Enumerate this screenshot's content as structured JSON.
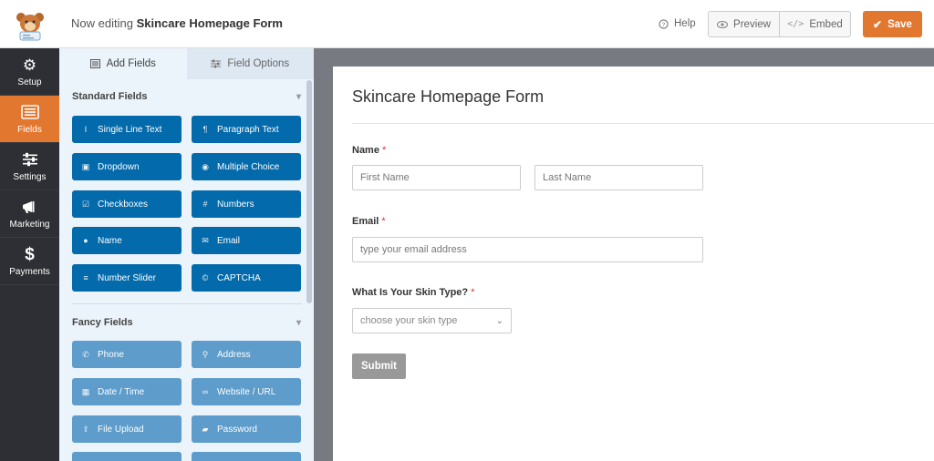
{
  "header": {
    "editing_prefix": "Now editing",
    "form_name": "Skincare Homepage Form",
    "help_label": "Help",
    "preview_label": "Preview",
    "embed_label": "Embed",
    "save_label": "Save",
    "accent_color": "#e27730"
  },
  "nav": [
    {
      "label": "Setup",
      "icon": "gear-icon"
    },
    {
      "label": "Fields",
      "icon": "fields-icon",
      "active": true
    },
    {
      "label": "Settings",
      "icon": "sliders-icon"
    },
    {
      "label": "Marketing",
      "icon": "megaphone-icon"
    },
    {
      "label": "Payments",
      "icon": "dollar-icon"
    }
  ],
  "panel": {
    "tabs": [
      {
        "label": "Add Fields",
        "icon": "list-icon",
        "active": true
      },
      {
        "label": "Field Options",
        "icon": "sliders-icon"
      }
    ],
    "standard_title": "Standard Fields",
    "standard_fields": [
      {
        "label": "Single Line Text",
        "icon": "text-cursor-icon"
      },
      {
        "label": "Paragraph Text",
        "icon": "paragraph-icon"
      },
      {
        "label": "Dropdown",
        "icon": "dropdown-icon"
      },
      {
        "label": "Multiple Choice",
        "icon": "radio-icon"
      },
      {
        "label": "Checkboxes",
        "icon": "checkbox-icon"
      },
      {
        "label": "Numbers",
        "icon": "hash-icon"
      },
      {
        "label": "Name",
        "icon": "user-icon"
      },
      {
        "label": "Email",
        "icon": "envelope-icon"
      },
      {
        "label": "Number Slider",
        "icon": "slider-icon"
      },
      {
        "label": "CAPTCHA",
        "icon": "captcha-icon"
      }
    ],
    "fancy_title": "Fancy Fields",
    "fancy_fields": [
      {
        "label": "Phone",
        "icon": "phone-icon"
      },
      {
        "label": "Address",
        "icon": "map-pin-icon"
      },
      {
        "label": "Date / Time",
        "icon": "calendar-icon"
      },
      {
        "label": "Website / URL",
        "icon": "link-icon"
      },
      {
        "label": "File Upload",
        "icon": "upload-icon"
      },
      {
        "label": "Password",
        "icon": "lock-icon"
      }
    ]
  },
  "form": {
    "title": "Skincare Homepage Form",
    "name_label": "Name",
    "first_name_placeholder": "First Name",
    "last_name_placeholder": "Last Name",
    "email_label": "Email",
    "email_placeholder": "type your email address",
    "skin_label": "What Is Your Skin Type?",
    "skin_placeholder": "choose your skin type",
    "required_mark": "*",
    "submit_label": "Submit"
  }
}
